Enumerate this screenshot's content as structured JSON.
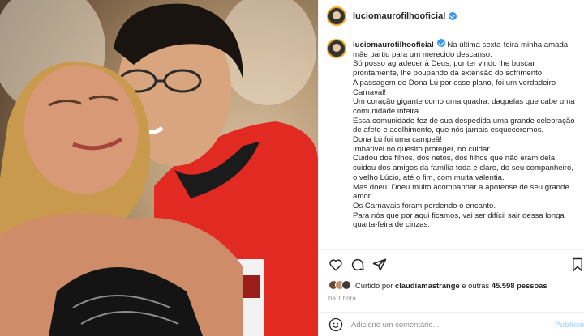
{
  "post": {
    "username": "luciomaurofilhooficial",
    "caption_lines": [
      "Na última sexta-feira minha amada",
      "mãe partiu para um merecido descanso.",
      "Só posso agradecer à Deus, por ter vindo lhe buscar",
      "prontamente, lhe poupando da extensão do sofrimento.",
      "A passagem de Dona Lú por esse plano, foi um verdadeiro",
      "Carnaval!",
      "Um coração gigante como uma quadra, daquelas que cabe uma",
      "comunidade inteira.",
      "Essa comunidade fez de sua despedida uma grande celebração",
      "de afeto e acolhimento, que nós jamais esqueceremos.",
      "Dona Lú foi uma campeã!",
      "Imbatível no quesito proteger, no cuidar.",
      "Cuidou dos filhos, dos netos, dos filhos que não eram dela,",
      "cuidou dos amigos da família toda e claro, do seu companheiro,",
      "o velho Lúcio, até o fim, com muita valentia.",
      "Mas doeu. Doeu muito acompanhar a apoteose de seu grande",
      "amor.",
      "Os Carnavais foram perdendo o encanto.",
      "Para nós que por aqui ficamos, vai ser difícil sair dessa longa",
      "quarta-feira de cinzas."
    ],
    "liked_prefix": "Curtido por ",
    "liked_user": "claudiamastrange",
    "liked_mid": " e outras ",
    "liked_count": "45.598 pessoas",
    "time_ago": "há 1 hora",
    "comment_placeholder": "Adicione um comentário...",
    "publish_label": "Publicar"
  },
  "icons": {
    "like": "heart-icon",
    "comment": "comment-icon",
    "share": "share-icon",
    "save": "bookmark-icon",
    "emoji": "emoji-icon",
    "verified": "verified-badge-icon"
  },
  "colors": {
    "verified": "#3897f0",
    "text": "#262626",
    "muted": "#8e8e8e",
    "publish": "#b3dbff",
    "shirt": "#e02a22"
  }
}
